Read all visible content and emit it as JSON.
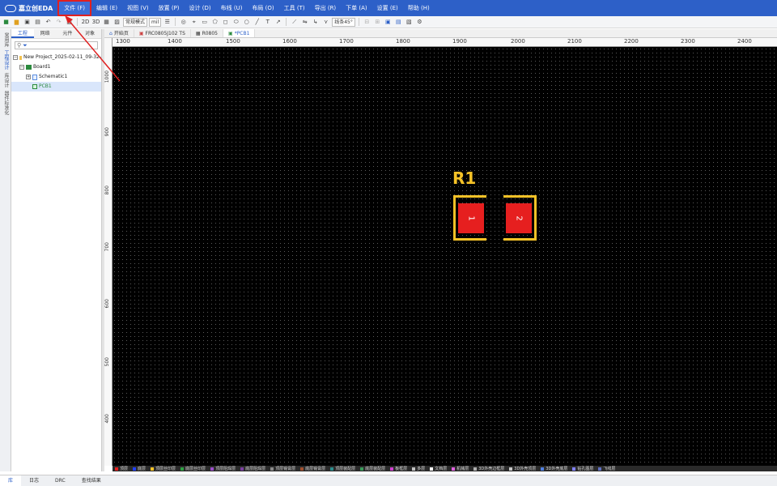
{
  "app": {
    "logo_text": "嘉立创EDA"
  },
  "menu": [
    {
      "label": "文件 (F)"
    },
    {
      "label": "编辑 (E)"
    },
    {
      "label": "视图 (V)"
    },
    {
      "label": "放置 (P)"
    },
    {
      "label": "设计 (D)"
    },
    {
      "label": "布线 (U)"
    },
    {
      "label": "布局 (O)"
    },
    {
      "label": "工具 (T)"
    },
    {
      "label": "导出 (R)"
    },
    {
      "label": "下单 (A)"
    },
    {
      "label": "设置 (E)"
    },
    {
      "label": "帮助 (H)"
    }
  ],
  "toolbar": {
    "view_2d": "2D",
    "view_3d": "3D",
    "mode_select": "常规模式",
    "unit_select": "mil",
    "angle_select": "线条45°"
  },
  "left_rail": [
    "常用库",
    "工程设计",
    "库设计",
    "器件标准化"
  ],
  "panel": {
    "tabs": [
      "工程",
      "网络",
      "元件",
      "对象"
    ],
    "search_placeholder": "",
    "tree": {
      "project": "New Project_2025-02-11_09-32-",
      "board": "Board1",
      "schematic": "Schematic1",
      "pcb": "PCB1"
    }
  },
  "doc_tabs": [
    "开始页",
    "FRC0805J102 TS",
    "R0805",
    "*PCB1"
  ],
  "ruler": {
    "top": [
      "1300",
      "1400",
      "1500",
      "1600",
      "1700",
      "1800",
      "1900",
      "2000",
      "2100",
      "2200",
      "2300",
      "2400"
    ],
    "left": [
      "1000",
      "900",
      "800",
      "700",
      "600",
      "500",
      "400"
    ]
  },
  "canvas": {
    "designator": "R1",
    "pads": [
      "1",
      "2"
    ]
  },
  "layers": [
    {
      "name": "顶层",
      "color": "#e61f1f"
    },
    {
      "name": "底层",
      "color": "#2040ff"
    },
    {
      "name": "顶层丝印层",
      "color": "#f5c227"
    },
    {
      "name": "底层丝印层",
      "color": "#2ea043"
    },
    {
      "name": "顶层阻焊层",
      "color": "#9b4dca"
    },
    {
      "name": "底层阻焊层",
      "color": "#7a3fa0"
    },
    {
      "name": "顶层锡膏层",
      "color": "#8a8a8a"
    },
    {
      "name": "底层锡膏层",
      "color": "#a05030"
    },
    {
      "name": "顶层装配层",
      "color": "#2c8c8c"
    },
    {
      "name": "底层装配层",
      "color": "#3a9a5a"
    },
    {
      "name": "板框层",
      "color": "#d040d0"
    },
    {
      "name": "多层",
      "color": "#c0c0c0"
    },
    {
      "name": "文档层",
      "color": "#ffffff"
    },
    {
      "name": "机械层",
      "color": "#e060e0"
    },
    {
      "name": "3D外壳边框层",
      "color": "#b0b0b0"
    },
    {
      "name": "3D外壳顶层",
      "color": "#c8c8c8"
    },
    {
      "name": "3D外壳底层",
      "color": "#5080e0"
    },
    {
      "name": "钻孔图层",
      "color": "#8080ff"
    },
    {
      "name": "飞线层",
      "color": "#6070c0"
    }
  ],
  "bottom_tabs": [
    "库",
    "日志",
    "DRC",
    "查找结果"
  ]
}
